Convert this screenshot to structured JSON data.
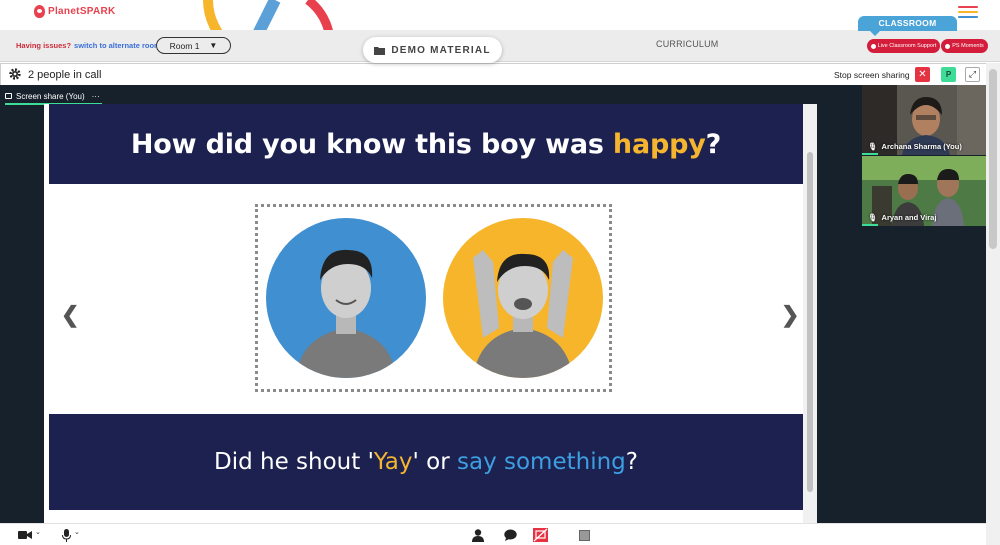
{
  "header": {
    "logo_text_a": "Planet",
    "logo_text_b": "SPARK"
  },
  "subbar": {
    "issues_text": "Having issues?",
    "alt_room_link": "switch to alternate room",
    "room_label": "Room 1",
    "demo_material": "DEMO MATERIAL",
    "curriculum": "CURRICULUM",
    "classroom_tab": "CLASSROOM",
    "live_support": "Live Classroom Support",
    "ps_moments": "PS Moments"
  },
  "call": {
    "people_count": "2 people in call",
    "stop_sharing": "Stop screen sharing",
    "stop_x": "✕",
    "p_badge": "P",
    "share_tab": "Screen share (You)",
    "share_menu": "···"
  },
  "slide": {
    "question_a": "How did you know this boy was ",
    "question_hl": "happy",
    "question_end": "?",
    "answer_a": "Did he shout '",
    "answer_y": "Yay",
    "answer_b": "' or ",
    "answer_c": "say something",
    "answer_end": "?"
  },
  "participants": [
    {
      "name": "Archana Sharma (You)"
    },
    {
      "name": "Aryan and Viraj"
    }
  ],
  "colors": {
    "brand_red": "#d41d3a",
    "classroom_blue": "#4aa4d8",
    "accent_green": "#3ddc97",
    "slide_navy": "#1c2150",
    "highlight_yellow": "#f5b52e",
    "highlight_blue": "#3d9ee0"
  },
  "icons": [
    "gear-icon",
    "camera-icon",
    "mic-icon",
    "person-icon",
    "chat-icon",
    "screen-share-off-icon",
    "stop-icon",
    "folder-icon",
    "menu-icon",
    "expand-icon"
  ]
}
